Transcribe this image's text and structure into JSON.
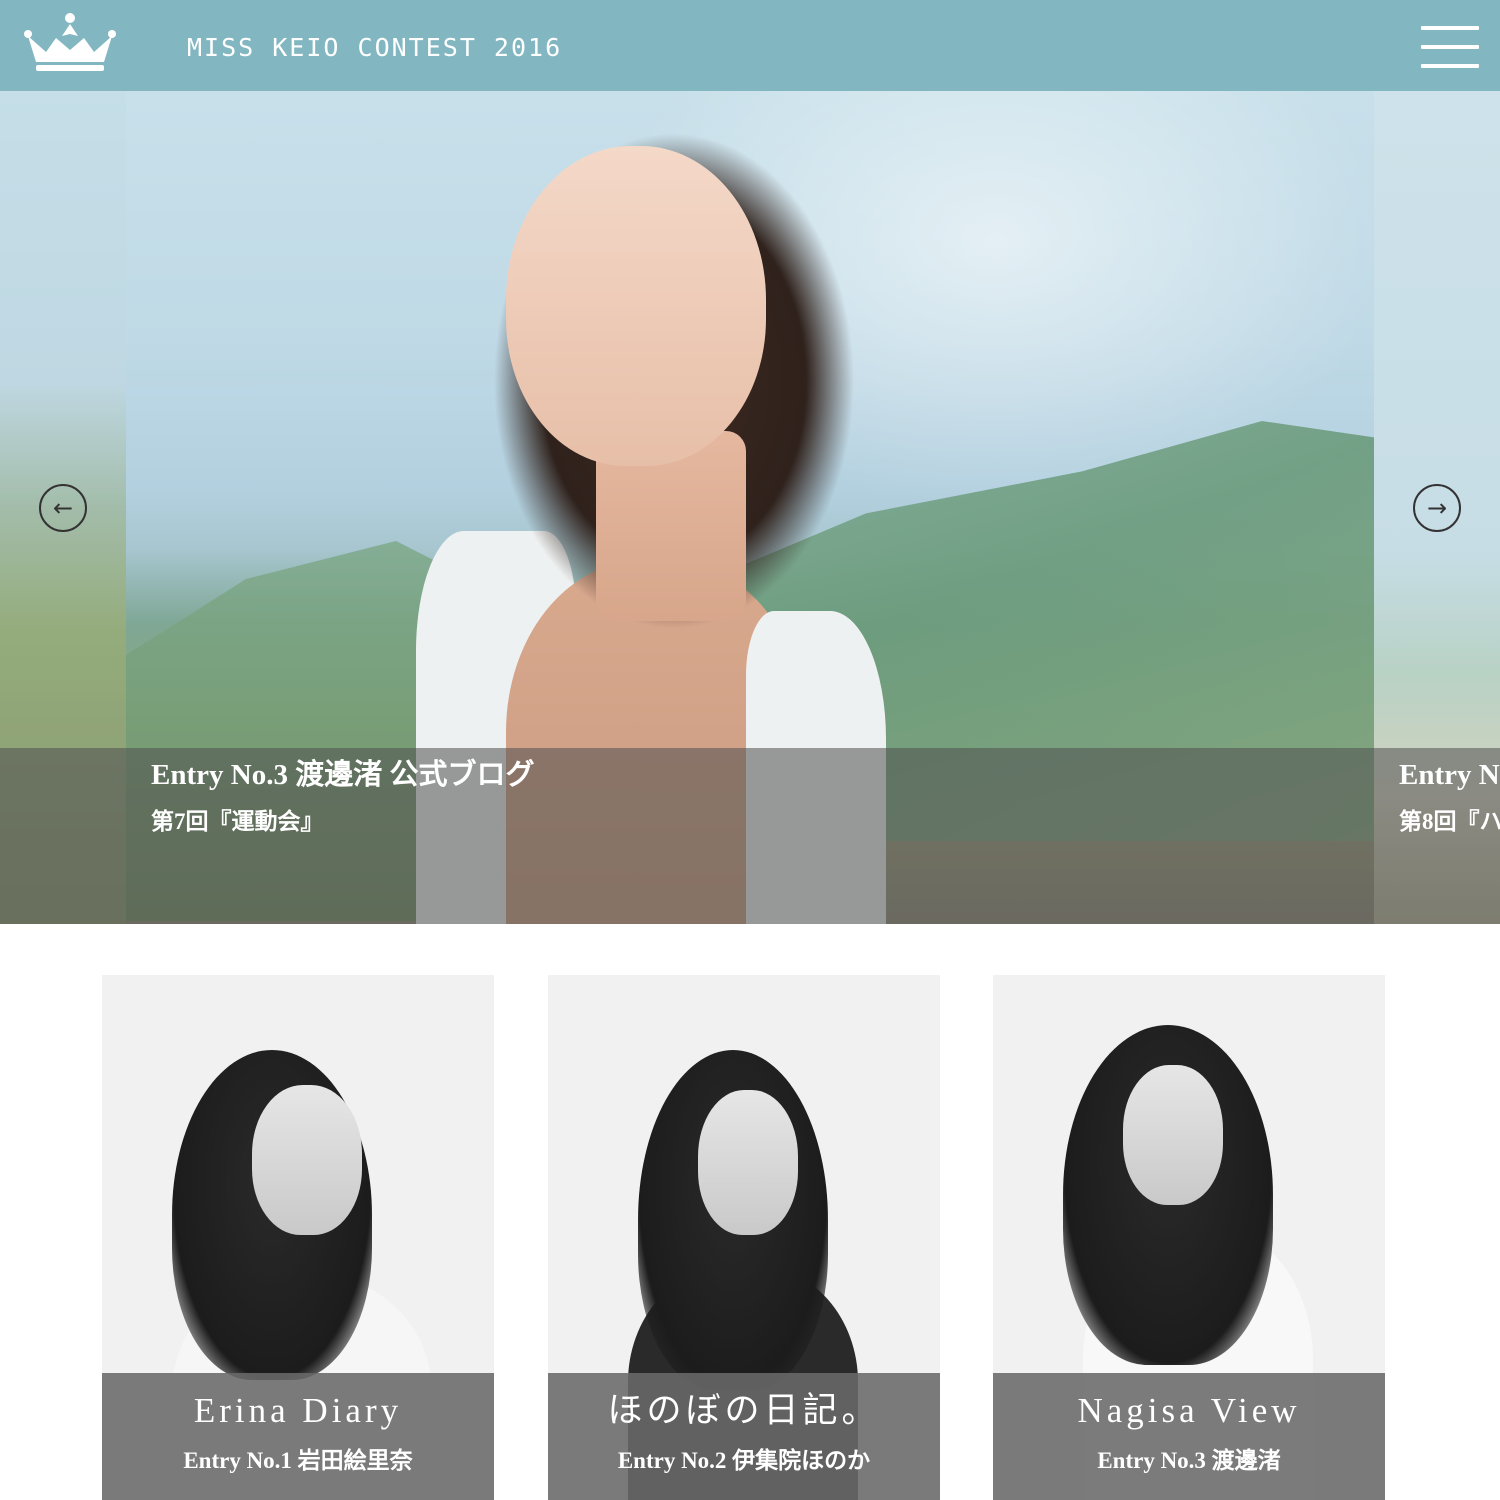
{
  "header": {
    "logo_icon": "crown-icon",
    "title": "MISS KEIO CONTEST 2016",
    "menu_icon": "hamburger-menu-icon",
    "background_color": "#82b7c2"
  },
  "slider": {
    "prev_icon": "arrow-left-icon",
    "next_icon": "arrow-right-icon",
    "prev_label": "←",
    "next_label": "→",
    "current": {
      "title": "Entry No.3 渡邊渚 公式ブログ",
      "subtitle": "第7回『運動会』"
    },
    "next_peek": {
      "title": "Entry N",
      "subtitle": "第8回『ハ"
    }
  },
  "cards": [
    {
      "blog_title": "Erina Diary",
      "entry": "Entry No.1 岩田絵里奈"
    },
    {
      "blog_title": "ほのぼの日記。",
      "entry": "Entry No.2 伊集院ほのか"
    },
    {
      "blog_title": "Nagisa View",
      "entry": "Entry No.3 渡邊渚"
    }
  ]
}
